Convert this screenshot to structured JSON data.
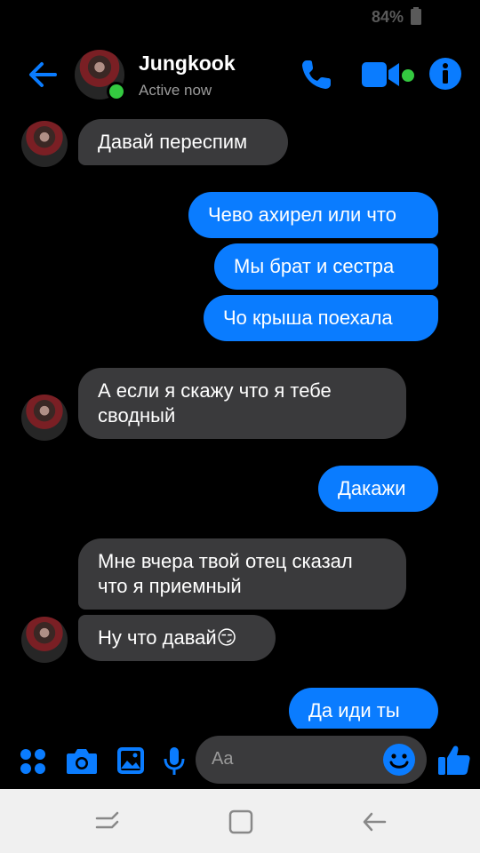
{
  "status_bar": {
    "battery": "84%"
  },
  "header": {
    "contact_name": "Jungkook",
    "contact_status": "Active now",
    "icons": [
      "back-arrow-icon",
      "phone-icon",
      "video-camera-icon",
      "info-icon"
    ],
    "accent_color": "#0a7cff",
    "online_color": "#34c940"
  },
  "messages": [
    {
      "dir": "in",
      "text": "Давай переспим"
    },
    {
      "dir": "out",
      "text": "Чево ахирел или что"
    },
    {
      "dir": "out",
      "text": "Мы брат и сестра"
    },
    {
      "dir": "out",
      "text": "Чо крыша поехала"
    },
    {
      "dir": "in",
      "text": "А если я скажу что я тебе\nсводный"
    },
    {
      "dir": "out",
      "text": "Дакажи"
    },
    {
      "dir": "in",
      "text": "Мне вчера твой отец сказал\nчто я приемный"
    },
    {
      "dir": "in",
      "text": "Ну что давай😏"
    },
    {
      "dir": "out",
      "text": "Да иди ты"
    }
  ],
  "composer": {
    "placeholder": "Aa",
    "icons": [
      "apps-grid-icon",
      "camera-icon",
      "image-icon",
      "microphone-icon",
      "emoji-icon",
      "thumbs-up-icon"
    ]
  },
  "navbar": {
    "icons": [
      "recent-apps-icon",
      "home-icon",
      "back-icon"
    ]
  }
}
